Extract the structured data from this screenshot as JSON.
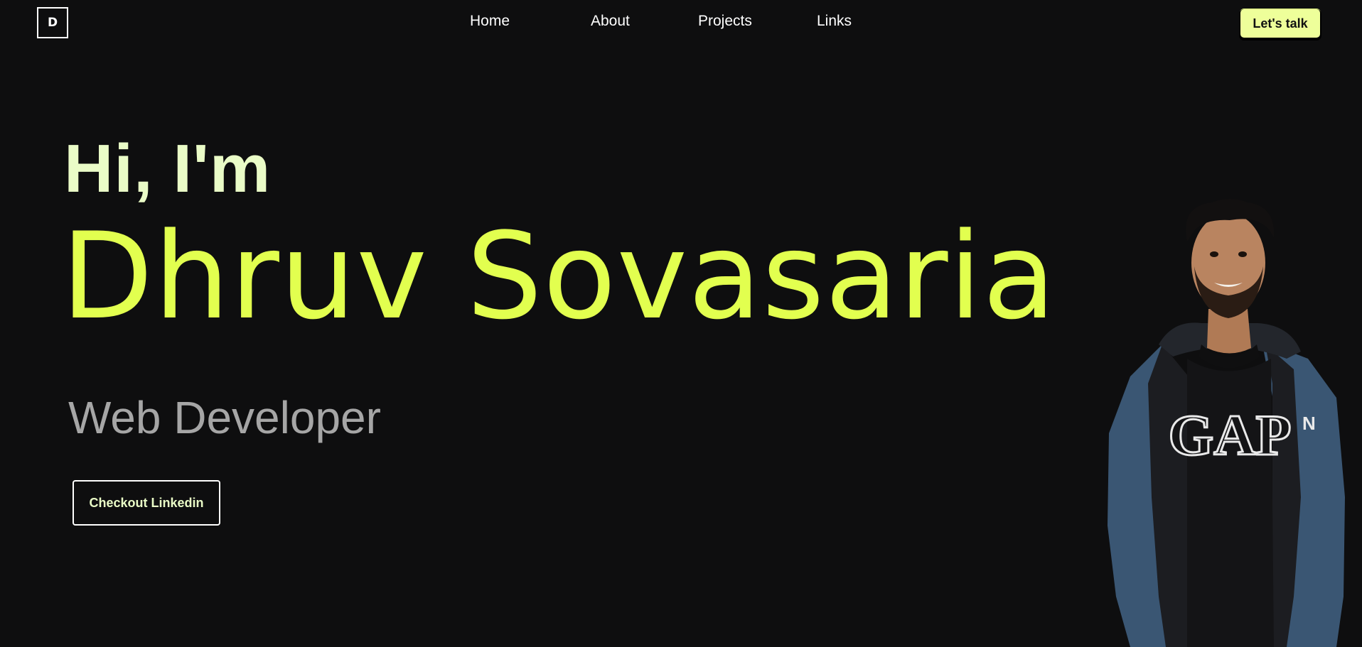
{
  "logo": {
    "letter": "D"
  },
  "nav": {
    "links": [
      {
        "label": "Home"
      },
      {
        "label": "About"
      },
      {
        "label": "Projects"
      },
      {
        "label": "Links"
      }
    ],
    "cta_label": "Let's talk"
  },
  "hero": {
    "greeting": "Hi, I'm",
    "name": "Dhruv Sovasaria",
    "role": "Web Developer",
    "button_label": "Checkout Linkedin"
  },
  "colors": {
    "background": "#0e0e0f",
    "accent": "#e2ff4f",
    "accent_light": "#eafcc7",
    "cta_bg": "#eeff9a",
    "muted_text": "#a6a6a6"
  },
  "icons": {
    "portrait": "person-photo"
  }
}
